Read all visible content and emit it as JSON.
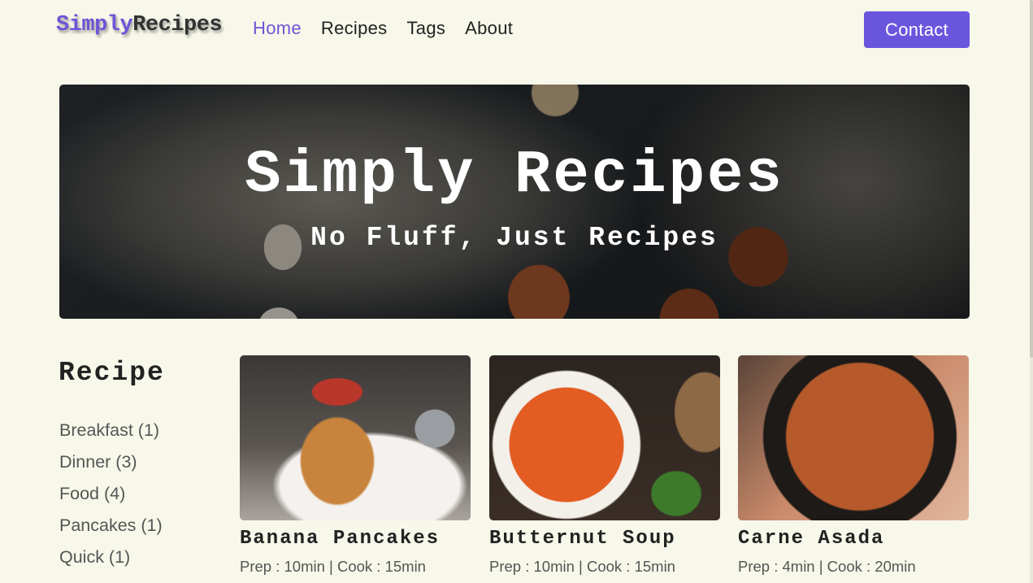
{
  "nav": {
    "logo_part1": "Simply",
    "logo_part2": "Recipes",
    "links": [
      {
        "label": "Home",
        "active": true
      },
      {
        "label": "Recipes",
        "active": false
      },
      {
        "label": "Tags",
        "active": false
      },
      {
        "label": "About",
        "active": false
      }
    ],
    "contact_label": "Contact"
  },
  "hero": {
    "title": "Simply Recipes",
    "subtitle": "No Fluff, Just Recipes"
  },
  "sidebar": {
    "title": "Recipe",
    "tags": [
      "Breakfast (1)",
      "Dinner (3)",
      "Food (4)",
      "Pancakes (1)",
      "Quick (1)"
    ]
  },
  "recipes": [
    {
      "name": "Banana Pancakes",
      "meta": "Prep : 10min | Cook : 15min"
    },
    {
      "name": "Butternut Soup",
      "meta": "Prep : 10min | Cook : 15min"
    },
    {
      "name": "Carne Asada",
      "meta": "Prep : 4min | Cook : 20min"
    }
  ],
  "colors": {
    "accent": "#6a55dd",
    "background": "#f7f7ea"
  }
}
